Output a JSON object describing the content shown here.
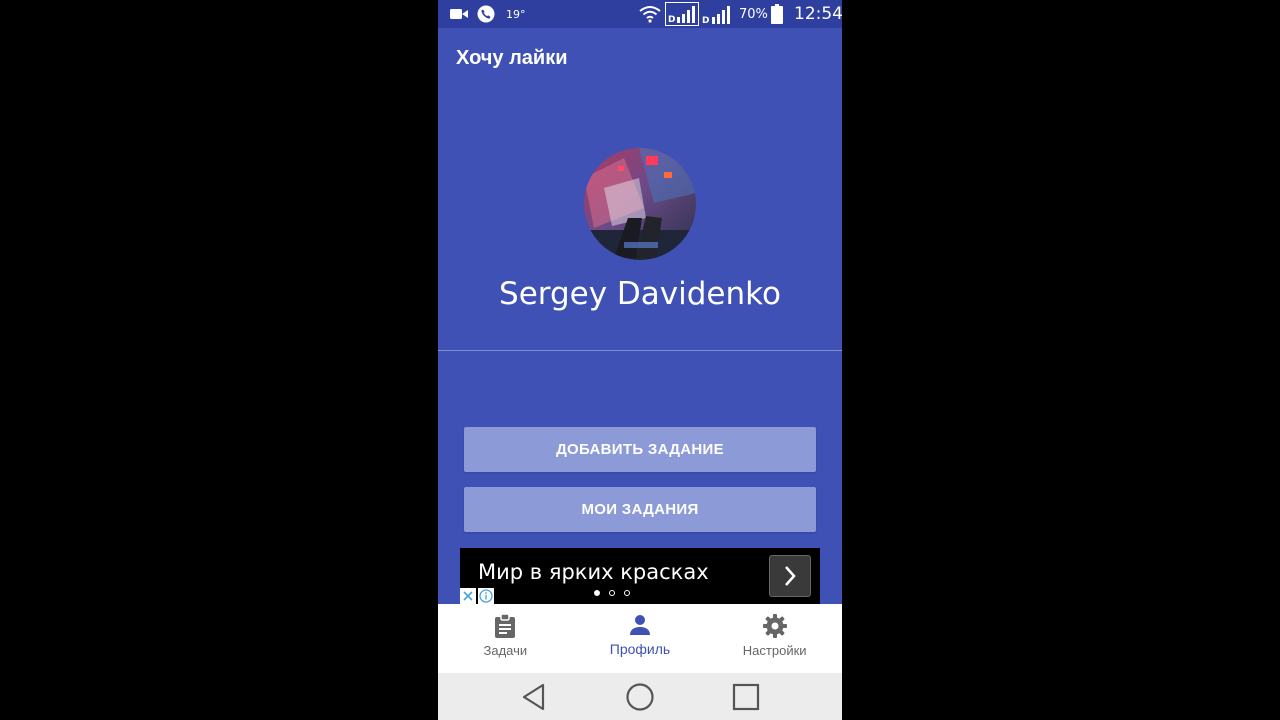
{
  "status_bar": {
    "temperature": "19°",
    "battery_percent": "70%",
    "time": "12:54",
    "icons": [
      "video-camera-icon",
      "phone-call-icon",
      "wifi-icon",
      "signal-sim1-icon",
      "signal-sim2-icon",
      "battery-icon"
    ]
  },
  "app_bar": {
    "title": "Хочу лайки"
  },
  "profile": {
    "name": "Sergey Davidenko",
    "avatar_icon": "avatar-photo"
  },
  "actions": {
    "add_task_label": "ДОБАВИТЬ ЗАДАНИЕ",
    "my_tasks_label": "МОИ ЗАДАНИЯ"
  },
  "ad_banner": {
    "text": "Мир в ярких красках",
    "next_icon": "chevron-right-icon",
    "page_count": 3,
    "active_page": 1
  },
  "bottom_nav": {
    "items": [
      {
        "label": "Задачи",
        "icon": "clipboard-icon",
        "active": false
      },
      {
        "label": "Профиль",
        "icon": "person-icon",
        "active": true
      },
      {
        "label": "Настройки",
        "icon": "gear-icon",
        "active": false
      }
    ]
  },
  "system_nav": {
    "icons": [
      "back-icon",
      "home-icon",
      "recents-icon"
    ]
  },
  "colors": {
    "primary": "#3f51b5",
    "status_bar": "#2f3fa0",
    "button": "#8c9ad8",
    "nav_inactive": "#666666"
  }
}
